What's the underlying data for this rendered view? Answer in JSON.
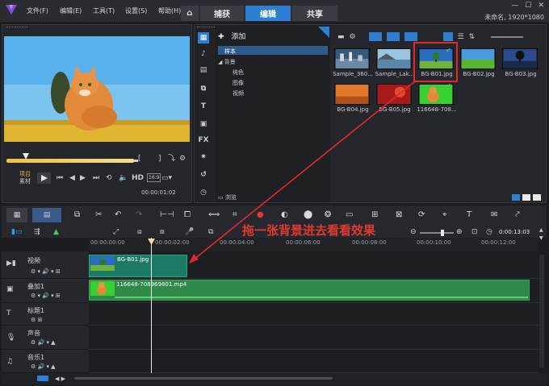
{
  "menubar": {
    "items": [
      "文件(F)",
      "编辑(E)",
      "工具(T)",
      "设置(S)",
      "帮助(H)"
    ],
    "tabs": {
      "home": "⌂",
      "capture": "捕获",
      "edit": "编辑",
      "share": "共享"
    },
    "project_info": "未命名, 1920*1080"
  },
  "player": {
    "modes": [
      "项目",
      "素材"
    ],
    "hd": "HD",
    "aspect": "16:9",
    "timecode": "00:00:01:02"
  },
  "library": {
    "add_label": "添加",
    "tree": {
      "root": "样本",
      "group": "背景",
      "children": [
        "纯色",
        "图像",
        "视频"
      ]
    },
    "browse_label": "浏览",
    "thumbnails": [
      {
        "label": "Sample_360...",
        "theme": "city"
      },
      {
        "label": "Sample_Lak...",
        "theme": "lake"
      },
      {
        "label": "BG-B01.jpg",
        "theme": "tree"
      },
      {
        "label": "BG-B02.jpg",
        "theme": "field"
      },
      {
        "label": "BG-B03.jpg",
        "theme": "sunset-tree"
      },
      {
        "label": "BG-B04.jpg",
        "theme": "orange"
      },
      {
        "label": "BG-B05.jpg",
        "theme": "red"
      },
      {
        "label": "116648-708...",
        "theme": "cat"
      }
    ]
  },
  "timeline": {
    "timecode": "0:00:13:03",
    "ruler": [
      "00:00:00:00",
      "00:00:02:00",
      "00:00:04:00",
      "00:00:06:00",
      "00:00:08:00",
      "00:00:10:00",
      "00:00:12:00"
    ],
    "tracks": [
      {
        "name": "视频"
      },
      {
        "name": "叠加1"
      },
      {
        "name": "标题1"
      },
      {
        "name": "声音"
      },
      {
        "name": "音乐1"
      }
    ],
    "clips": {
      "video": "BG-B01.jpg",
      "overlay": "116648-708969801.mp4"
    }
  },
  "annotation": "拖一张背景进去看看效果",
  "colors": {
    "accent": "#2e7fd4",
    "annotation": "#e03a2f",
    "video_clip": "#1c7a64",
    "overlay_clip": "#2f8a4a"
  }
}
